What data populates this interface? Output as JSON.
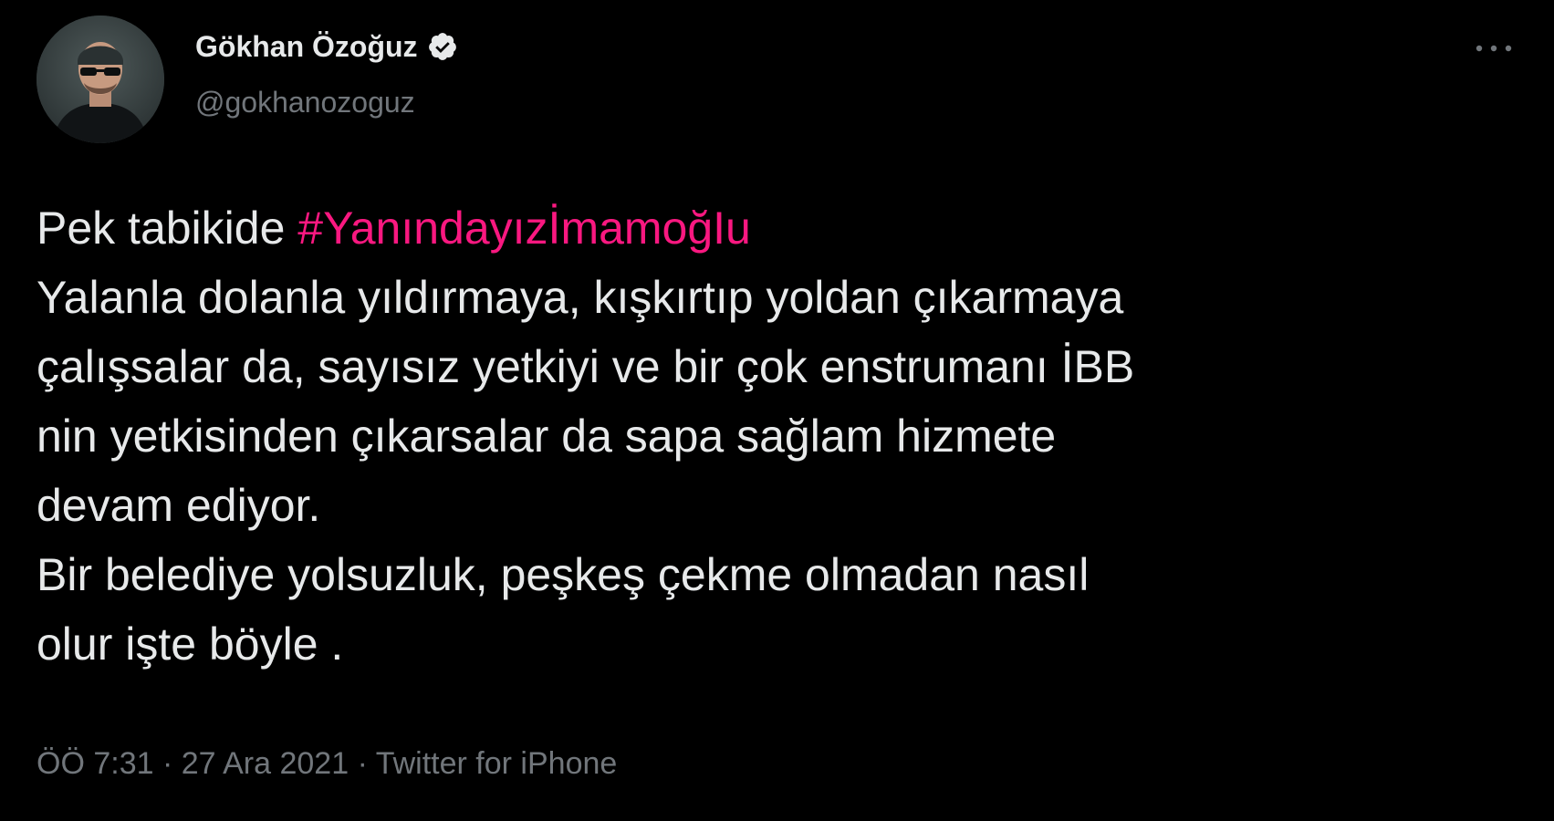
{
  "author": {
    "display_name": "Gökhan Özoğuz",
    "handle": "@gokhanozoguz",
    "verified_icon": "verified-badge-icon",
    "avatar_icon": "avatar-photo"
  },
  "menu": {
    "icon": "more-horizontal-icon"
  },
  "tweet": {
    "intro": "Pek tabikide ",
    "hashtag": "#YanındayızİmamoğIu",
    "lines": [
      "Yalanla dolanla yıldırmaya, kışkırtıp yoldan çıkarmaya",
      "çalışsalar da, sayısız yetkiyi ve bir çok enstrumanı İBB",
      "nin yetkisinden çıkarsalar da sapa sağlam hizmete",
      "devam ediyor.",
      "Bir belediye yolsuzluk, peşkeş çekme olmadan nasıl",
      "olur işte böyle ."
    ]
  },
  "meta": {
    "time": "ÖÖ 7:31",
    "separator1": " · ",
    "date": "27 Ara 2021",
    "separator2": " · ",
    "source": "Twitter for iPhone"
  },
  "colors": {
    "background": "#000000",
    "text": "#e7e9ea",
    "secondary": "#71767b",
    "hashtag": "#f91880"
  }
}
